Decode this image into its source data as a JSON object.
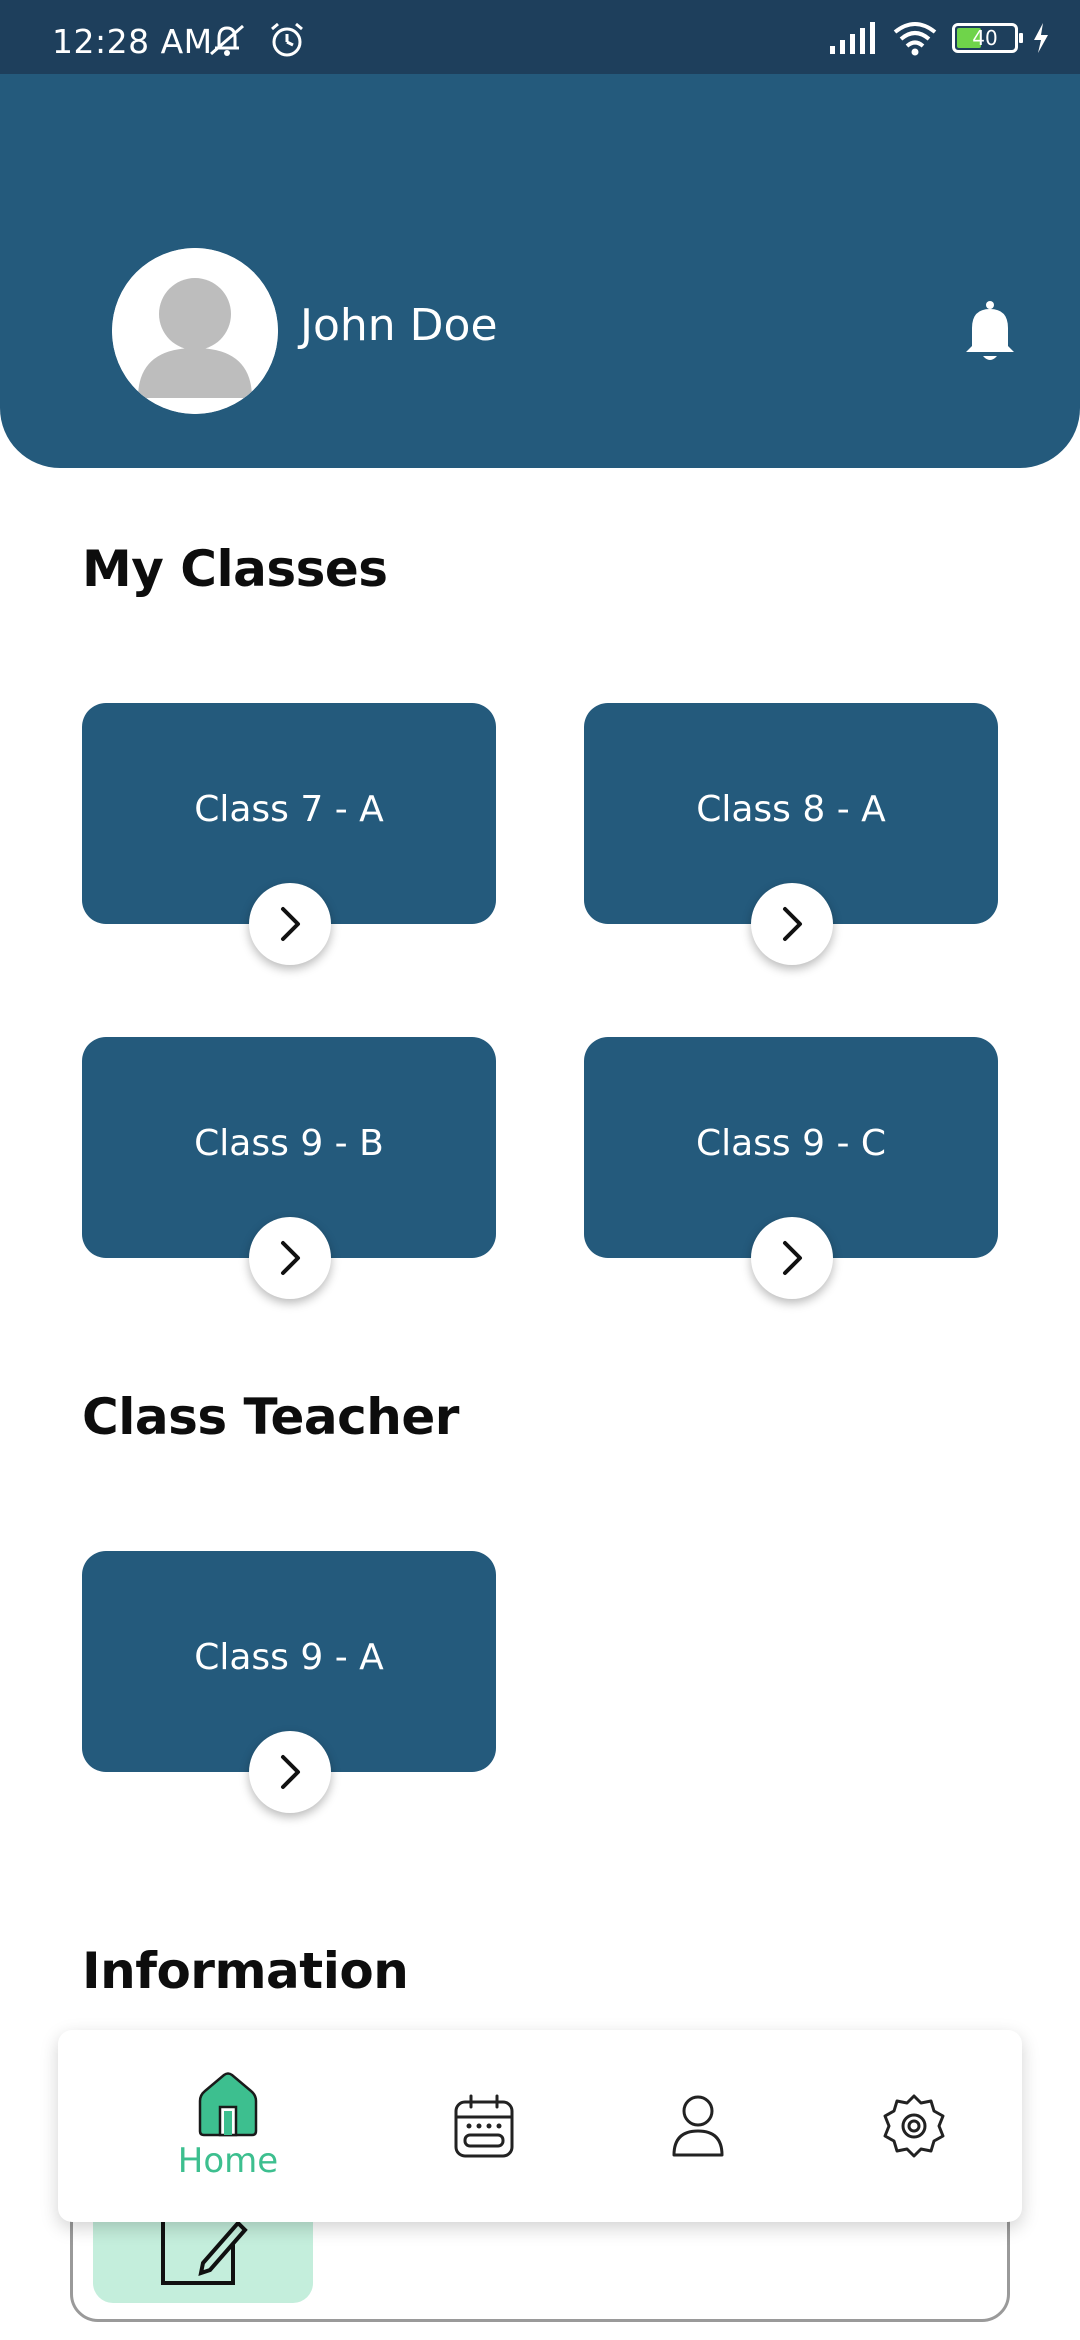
{
  "status_bar": {
    "time": "12:28 AM",
    "battery": "40",
    "icons": [
      "mute-icon",
      "alarm-icon",
      "signal-icon",
      "wifi-icon",
      "battery-icon",
      "charging-icon"
    ]
  },
  "header": {
    "user_name": "John Doe",
    "avatar_icon": "user-avatar-icon",
    "notification_icon": "bell-icon"
  },
  "my_classes": {
    "title": "My Classes",
    "items": [
      {
        "label": "Class 7 - A"
      },
      {
        "label": "Class 8 - A"
      },
      {
        "label": "Class 9 - B"
      },
      {
        "label": "Class 9 - C"
      }
    ]
  },
  "class_teacher": {
    "title": "Class Teacher",
    "items": [
      {
        "label": "Class 9 - A"
      }
    ]
  },
  "information": {
    "title": "Information"
  },
  "bottom_nav": {
    "items": [
      {
        "label": "Home",
        "icon": "home-icon",
        "active": true
      },
      {
        "label": "",
        "icon": "calendar-icon",
        "active": false
      },
      {
        "label": "",
        "icon": "profile-icon",
        "active": false
      },
      {
        "label": "",
        "icon": "settings-icon",
        "active": false
      }
    ]
  },
  "colors": {
    "primary": "#245a7c",
    "status_bar": "#1e3f5c",
    "accent": "#3dbf8f"
  }
}
